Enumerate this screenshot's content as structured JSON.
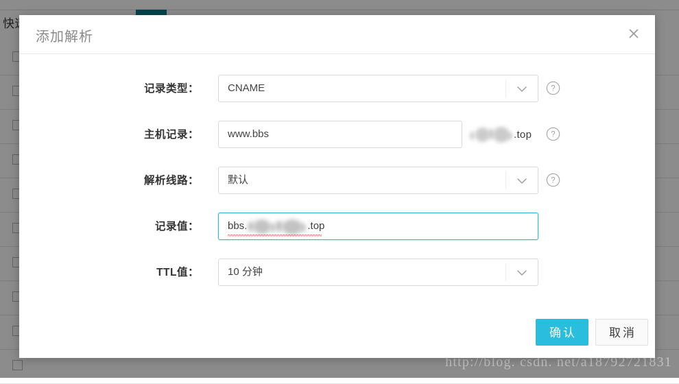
{
  "background": {
    "quick_label": "快速",
    "tab_color": "#0b7c8c",
    "rows": 10
  },
  "watermark": "http://blog. csdn. net/a18792721831",
  "modal": {
    "title": "添加解析",
    "close_icon": "close-icon",
    "fields": [
      {
        "key": "record_type",
        "label": "记录类型：",
        "value": "CNAME",
        "control": "select",
        "icon": "chevron-down-icon",
        "help": "help-circle-icon",
        "focused": false
      },
      {
        "key": "host_record",
        "label": "主机记录：",
        "value": "www.bbs",
        "control": "input",
        "suffix": ".top",
        "help": "help-circle-icon",
        "focused": false
      },
      {
        "key": "resolve_line",
        "label": "解析线路：",
        "value": "默认",
        "control": "select",
        "icon": "chevron-down-icon",
        "help": "help-circle-icon",
        "focused": false
      },
      {
        "key": "record_value",
        "label": "记录值：",
        "value_prefix": "bbs.",
        "value_suffix": ".top",
        "control": "input",
        "focused": true
      },
      {
        "key": "ttl",
        "label": "TTL值：",
        "value": "10 分钟",
        "control": "select",
        "icon": "chevron-down-icon",
        "focused": false
      }
    ],
    "buttons": {
      "confirm": "确认",
      "cancel": "取消",
      "confirm_color": "#29bede"
    }
  }
}
